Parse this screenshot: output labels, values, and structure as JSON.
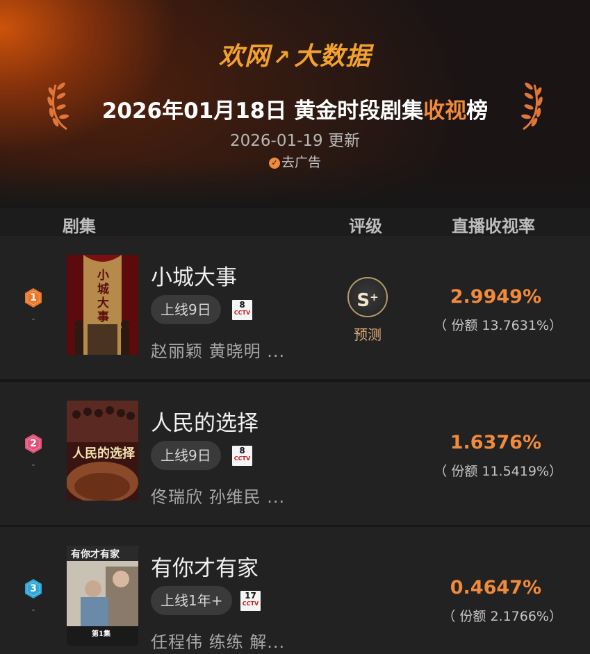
{
  "header": {
    "logo_text_1": "欢网",
    "logo_mark": "↗",
    "logo_text_2": "大数据",
    "title_main": "2026年01月18日 黄金时段剧集",
    "title_accent": "收视",
    "title_end": "榜",
    "update": "2026-01-19 更新",
    "remove_ads": "去广告"
  },
  "columns": {
    "drama": "剧集",
    "grade": "评级",
    "rating": "直播收视率"
  },
  "rows": [
    {
      "rank": "1",
      "rank_change": "-",
      "rank_color": "#e8772a",
      "name": "小城大事",
      "days": "上线9日",
      "channel_number": "8",
      "channel_logo": "CCTV",
      "cast": "赵丽颖 黄晓明 ...",
      "grade": "S",
      "grade_plus": "+",
      "grade_label": "预测",
      "rating": "2.9949%",
      "share": "（ 份额 13.7631%）",
      "poster_text": "小城大事"
    },
    {
      "rank": "2",
      "rank_change": "-",
      "rank_color": "#e0527a",
      "name": "人民的选择",
      "days": "上线9日",
      "channel_number": "8",
      "channel_logo": "CCTV",
      "cast": "佟瑞欣 孙维民 ...",
      "rating": "1.6376%",
      "share": "（ 份额 11.5419%）",
      "poster_text": "人民的选择"
    },
    {
      "rank": "3",
      "rank_change": "-",
      "rank_color": "#2fa7d6",
      "name": "有你才有家",
      "days": "上线1年+",
      "channel_number": "17",
      "channel_logo": "CCTV",
      "cast": "任程伟 练练 解...",
      "rating": "0.4647%",
      "share": "（ 份额 2.1766%）",
      "poster_text": "有你才有家",
      "poster_subtext": "第1集"
    }
  ]
}
